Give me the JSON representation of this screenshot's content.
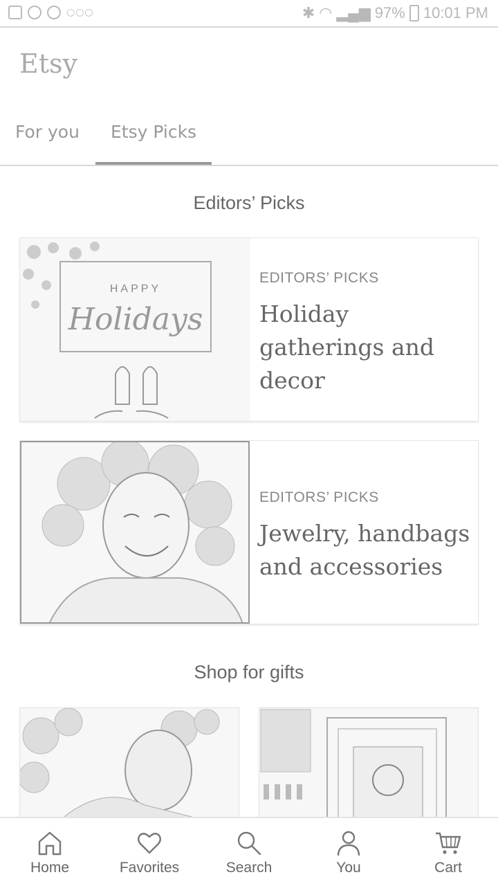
{
  "status_bar": {
    "battery": "97%",
    "time": "10:01 PM"
  },
  "app": {
    "logo": "Etsy"
  },
  "tabs": [
    {
      "label": "For you",
      "active": false
    },
    {
      "label": "Etsy Picks",
      "active": true
    }
  ],
  "editors_picks": {
    "section_title": "Editors’ Picks",
    "cards": [
      {
        "kicker": "EDITORS’ PICKS",
        "title": "Holiday gatherings and decor",
        "image_text": {
          "top": "HAPPY",
          "script": "Holidays"
        }
      },
      {
        "kicker": "EDITORS’ PICKS",
        "title": "Jewelry, handbags and accessories"
      }
    ]
  },
  "shop_for_gifts": {
    "section_title": "Shop for gifts"
  },
  "bottom_nav": [
    {
      "label": "Home",
      "icon": "home-icon"
    },
    {
      "label": "Favorites",
      "icon": "heart-icon"
    },
    {
      "label": "Search",
      "icon": "search-icon"
    },
    {
      "label": "You",
      "icon": "person-icon"
    },
    {
      "label": "Cart",
      "icon": "cart-icon"
    }
  ]
}
